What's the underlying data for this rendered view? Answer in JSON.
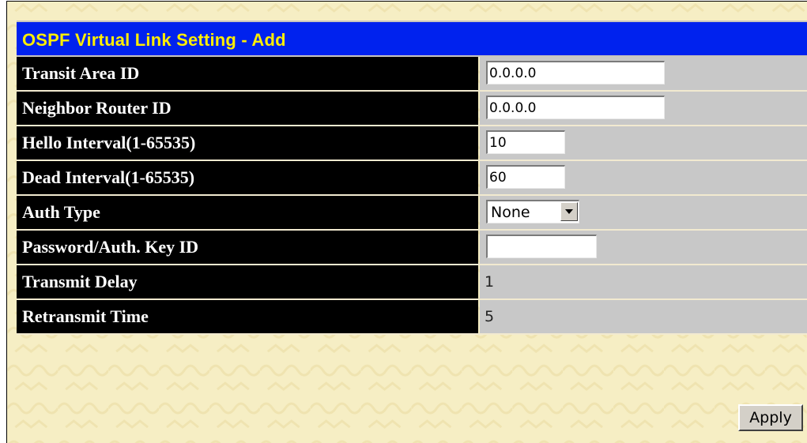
{
  "title": "OSPF Virtual Link Setting - Add",
  "colors": {
    "title_bg": "#0022ee",
    "title_text": "#ffee00",
    "label_bg": "#000000",
    "label_text": "#ffffff",
    "value_bg": "#c8c8c8",
    "page_bg": "#f6eec4"
  },
  "fields": {
    "transit_area_id": {
      "label": "Transit Area ID",
      "value": "0.0.0.0"
    },
    "neighbor_router_id": {
      "label": "Neighbor Router ID",
      "value": "0.0.0.0"
    },
    "hello_interval": {
      "label": "Hello Interval(1-65535)",
      "value": "10"
    },
    "dead_interval": {
      "label": "Dead Interval(1-65535)",
      "value": "60"
    },
    "auth_type": {
      "label": "Auth Type",
      "selected": "None"
    },
    "password_auth_key_id": {
      "label": "Password/Auth. Key ID",
      "value": ""
    },
    "transmit_delay": {
      "label": "Transmit Delay",
      "value": "1"
    },
    "retransmit_time": {
      "label": "Retransmit Time",
      "value": "5"
    }
  },
  "apply_label": "Apply",
  "icons": {
    "dropdown": "chevron-down-icon"
  }
}
